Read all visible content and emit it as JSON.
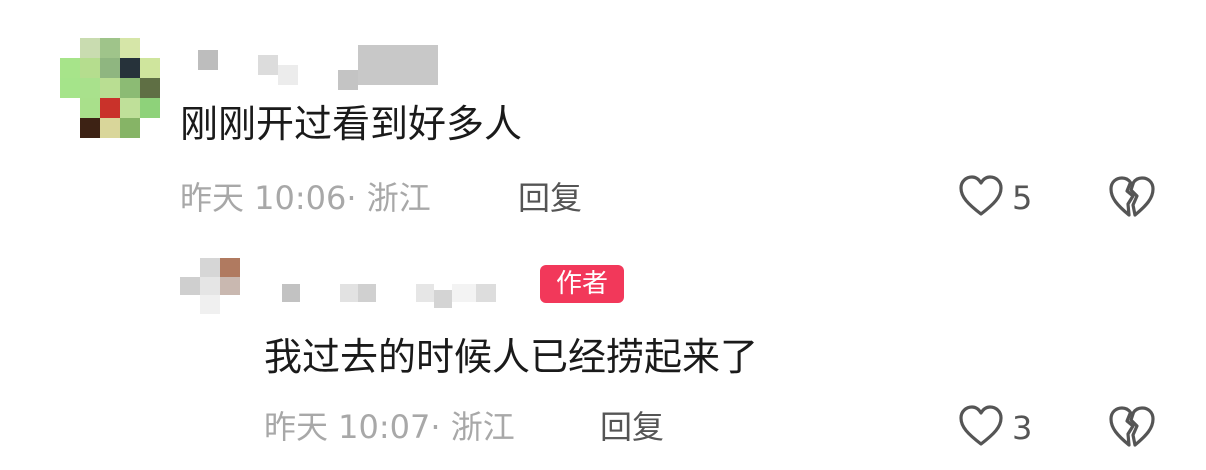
{
  "comments": [
    {
      "text": "刚刚开过看到好多人",
      "time_location": "昨天 10:06· 浙江",
      "reply_label": "回复",
      "likes": "5"
    }
  ],
  "reply": {
    "badge": "作者",
    "text": "我过去的时候人已经捞起来了",
    "time_location": "昨天 10:07· 浙江",
    "reply_label": "回复",
    "likes": "3"
  },
  "colors": {
    "badge_bg": "#f2385a",
    "icon_stroke": "#555555",
    "meta_text": "#a8a8a8"
  },
  "icons": [
    "heart-outline-icon",
    "broken-heart-icon"
  ]
}
